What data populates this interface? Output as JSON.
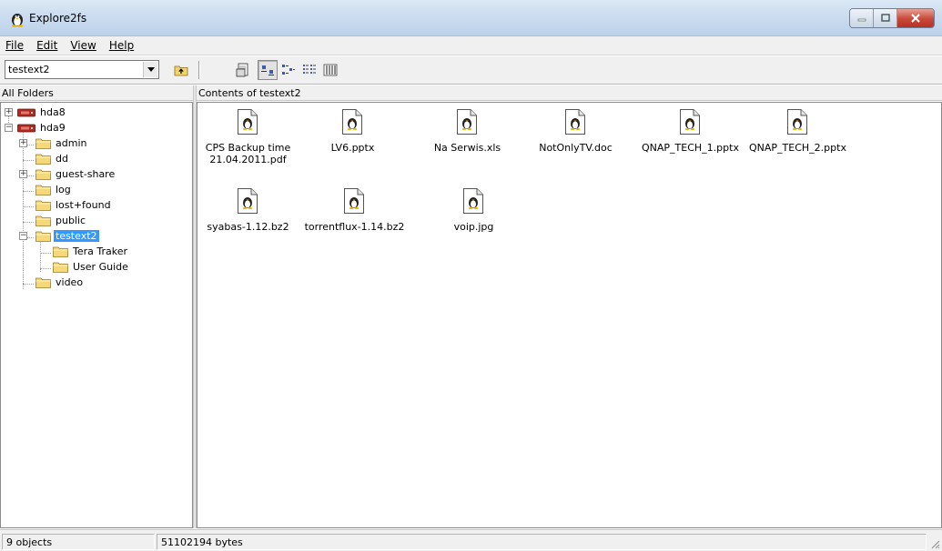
{
  "window": {
    "title": "Explore2fs"
  },
  "menu": [
    {
      "label": "File"
    },
    {
      "label": "Edit"
    },
    {
      "label": "View"
    },
    {
      "label": "Help"
    }
  ],
  "toolbar": {
    "path_combo_value": "testext2"
  },
  "left_pane": {
    "header": "All Folders"
  },
  "right_pane": {
    "header": "Contents of testext2"
  },
  "tree": [
    {
      "label": "hda8",
      "icon": "disk-icon"
    },
    {
      "label": "hda9",
      "icon": "disk-icon"
    },
    {
      "label": "admin",
      "icon": "folder-icon"
    },
    {
      "label": "dd",
      "icon": "folder-icon"
    },
    {
      "label": "guest-share",
      "icon": "folder-icon"
    },
    {
      "label": "log",
      "icon": "folder-icon"
    },
    {
      "label": "lost+found",
      "icon": "folder-icon"
    },
    {
      "label": "public",
      "icon": "folder-icon"
    },
    {
      "label": "testext2",
      "icon": "folder-icon",
      "selected": true
    },
    {
      "label": "Tera Traker",
      "icon": "folder-icon"
    },
    {
      "label": "User Guide",
      "icon": "folder-icon"
    },
    {
      "label": "video",
      "icon": "folder-icon"
    }
  ],
  "files": [
    {
      "name": "CPS Backup time 21.04.2011.pdf",
      "icon": "linux-penguin-file-icon"
    },
    {
      "name": "LV6.pptx",
      "icon": "linux-penguin-file-icon"
    },
    {
      "name": "Na Serwis.xls",
      "icon": "linux-penguin-file-icon"
    },
    {
      "name": "NotOnlyTV.doc",
      "icon": "linux-penguin-file-icon"
    },
    {
      "name": "QNAP_TECH_1.pptx",
      "icon": "linux-penguin-file-icon"
    },
    {
      "name": "QNAP_TECH_2.pptx",
      "icon": "linux-penguin-file-icon"
    },
    {
      "name": "syabas-1.12.bz2",
      "icon": "linux-penguin-file-icon"
    },
    {
      "name": "torrentflux-1.14.bz2",
      "icon": "linux-penguin-file-icon"
    },
    {
      "name": "voip.jpg",
      "icon": "linux-penguin-file-icon"
    }
  ],
  "status": {
    "objects": "9 objects",
    "bytes": "51102194 bytes"
  },
  "colors": {
    "selection": "#3399ff",
    "titlebar": "#c7d9ee",
    "close_button": "#c8483a"
  }
}
